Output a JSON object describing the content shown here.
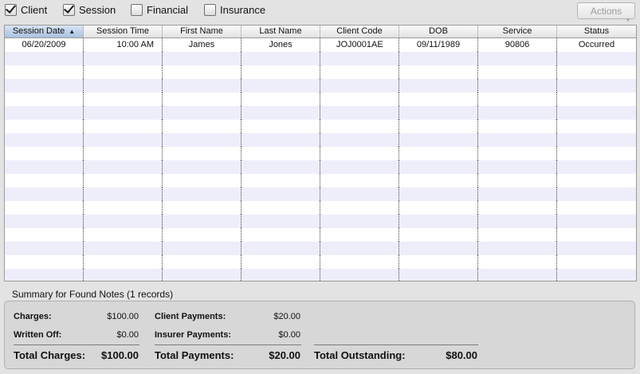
{
  "filters": [
    {
      "label": "Client",
      "checked": true
    },
    {
      "label": "Session",
      "checked": true
    },
    {
      "label": "Financial",
      "checked": false
    },
    {
      "label": "Insurance",
      "checked": false
    }
  ],
  "actions_label": "Actions",
  "table": {
    "columns": [
      "Session Date",
      "Session Time",
      "First Name",
      "Last Name",
      "Client Code",
      "DOB",
      "Service",
      "Status"
    ],
    "rows": [
      [
        "06/20/2009",
        "10:00 AM",
        "James",
        "Jones",
        "JOJ0001AE",
        "09/11/1989",
        "90806",
        "Occurred"
      ]
    ]
  },
  "summary": {
    "title": "Summary for Found Notes  (1 records)",
    "charges_label": "Charges:",
    "charges_value": "$100.00",
    "written_off_label": "Written Off:",
    "written_off_value": "$0.00",
    "total_charges_label": "Total Charges:",
    "total_charges_value": "$100.00",
    "client_payments_label": "Client Payments:",
    "client_payments_value": "$20.00",
    "insurer_payments_label": "Insurer Payments:",
    "insurer_payments_value": "$0.00",
    "total_payments_label": "Total Payments:",
    "total_payments_value": "$20.00",
    "total_outstanding_label": "Total Outstanding:",
    "total_outstanding_value": "$80.00"
  }
}
